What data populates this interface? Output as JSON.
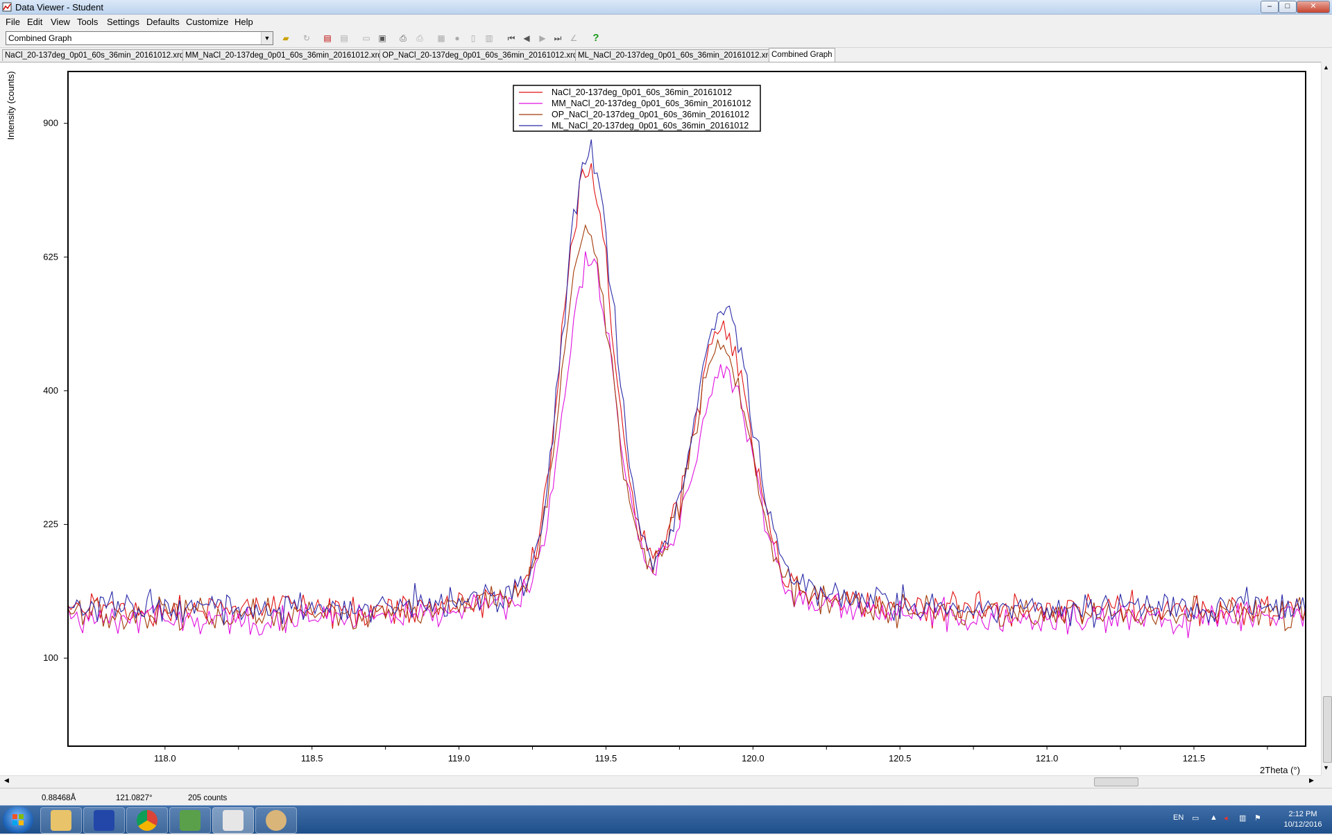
{
  "window": {
    "title": "Data Viewer - Student",
    "controls": [
      "–",
      "□",
      "✕"
    ]
  },
  "menu": [
    "File",
    "Edit",
    "View",
    "Tools",
    "Settings",
    "Defaults",
    "Customize",
    "Help"
  ],
  "toolbar": {
    "view_select": "Combined Graph",
    "icons": [
      "open-folder-icon",
      "refresh-icon",
      "export-icon",
      "copy-icon",
      "eraser-icon",
      "clipboard-icon",
      "print-icon",
      "print-preview-icon",
      "table-icon",
      "circle-icon",
      "page-icon",
      "page-print-icon",
      "first-icon",
      "previous-icon",
      "next-icon",
      "last-icon",
      "chart-icon",
      "help-icon"
    ]
  },
  "tabs": [
    {
      "label": "NaCl_20-137deg_0p01_60s_36min_20161012.xrdml",
      "active": false
    },
    {
      "label": "MM_NaCl_20-137deg_0p01_60s_36min_20161012.xrdml",
      "active": false
    },
    {
      "label": "OP_NaCl_20-137deg_0p01_60s_36min_20161012.xrdml",
      "active": false
    },
    {
      "label": "ML_NaCl_20-137deg_0p01_60s_36min_20161012.xrdml",
      "active": false
    },
    {
      "label": "Combined Graph",
      "active": true
    }
  ],
  "chart_data": {
    "type": "line",
    "title": "",
    "xlabel": "2Theta (°)",
    "ylabel": "Intensity (counts)",
    "xlim": [
      117.67,
      121.88
    ],
    "x_scale": "linear",
    "y_scale": "square-root",
    "ylim": [
      45,
      1020
    ],
    "xticks": [
      "118.0",
      "118.5",
      "119.0",
      "119.5",
      "120.0",
      "120.5",
      "121.0",
      "121.5"
    ],
    "yticks": [
      "100",
      "225",
      "400",
      "625",
      "900"
    ],
    "legend_placement": "top-center",
    "grid": false,
    "x_step": 0.01,
    "series": [
      {
        "name": "NaCl_20-137deg_0p01_60s_36min_20161012",
        "color": "#e01010",
        "base": 140,
        "peak_a": 620,
        "peak_b": 330,
        "noise": 14,
        "offset": 0.003
      },
      {
        "name": "MM_NaCl_20-137deg_0p01_60s_36min_20161012",
        "color": "#e010e0",
        "base": 132,
        "peak_a": 460,
        "peak_b": 260,
        "noise": 13,
        "offset": -0.004
      },
      {
        "name": "OP_NaCl_20-137deg_0p01_60s_36min_20161012",
        "color": "#a23a08",
        "base": 136,
        "peak_a": 500,
        "peak_b": 300,
        "noise": 13,
        "offset": 0.006
      },
      {
        "name": "ML_NaCl_20-137deg_0p01_60s_36min_20161012",
        "color": "#2a2aa8",
        "base": 142,
        "peak_a": 660,
        "peak_b": 360,
        "noise": 14,
        "offset": -0.002
      }
    ],
    "peaks_2theta": [
      119.44,
      119.9
    ]
  },
  "status": {
    "d_spacing": "0.88468Å",
    "two_theta": "121.0827°",
    "counts": "205 counts"
  },
  "taskbar": {
    "apps": [
      "file-explorer-icon",
      "save-disk-icon",
      "chrome-icon",
      "chart-app-icon",
      "microscope-icon",
      "paint-icon"
    ],
    "lang": "EN",
    "time": "2:12 PM",
    "date": "10/12/2016"
  }
}
